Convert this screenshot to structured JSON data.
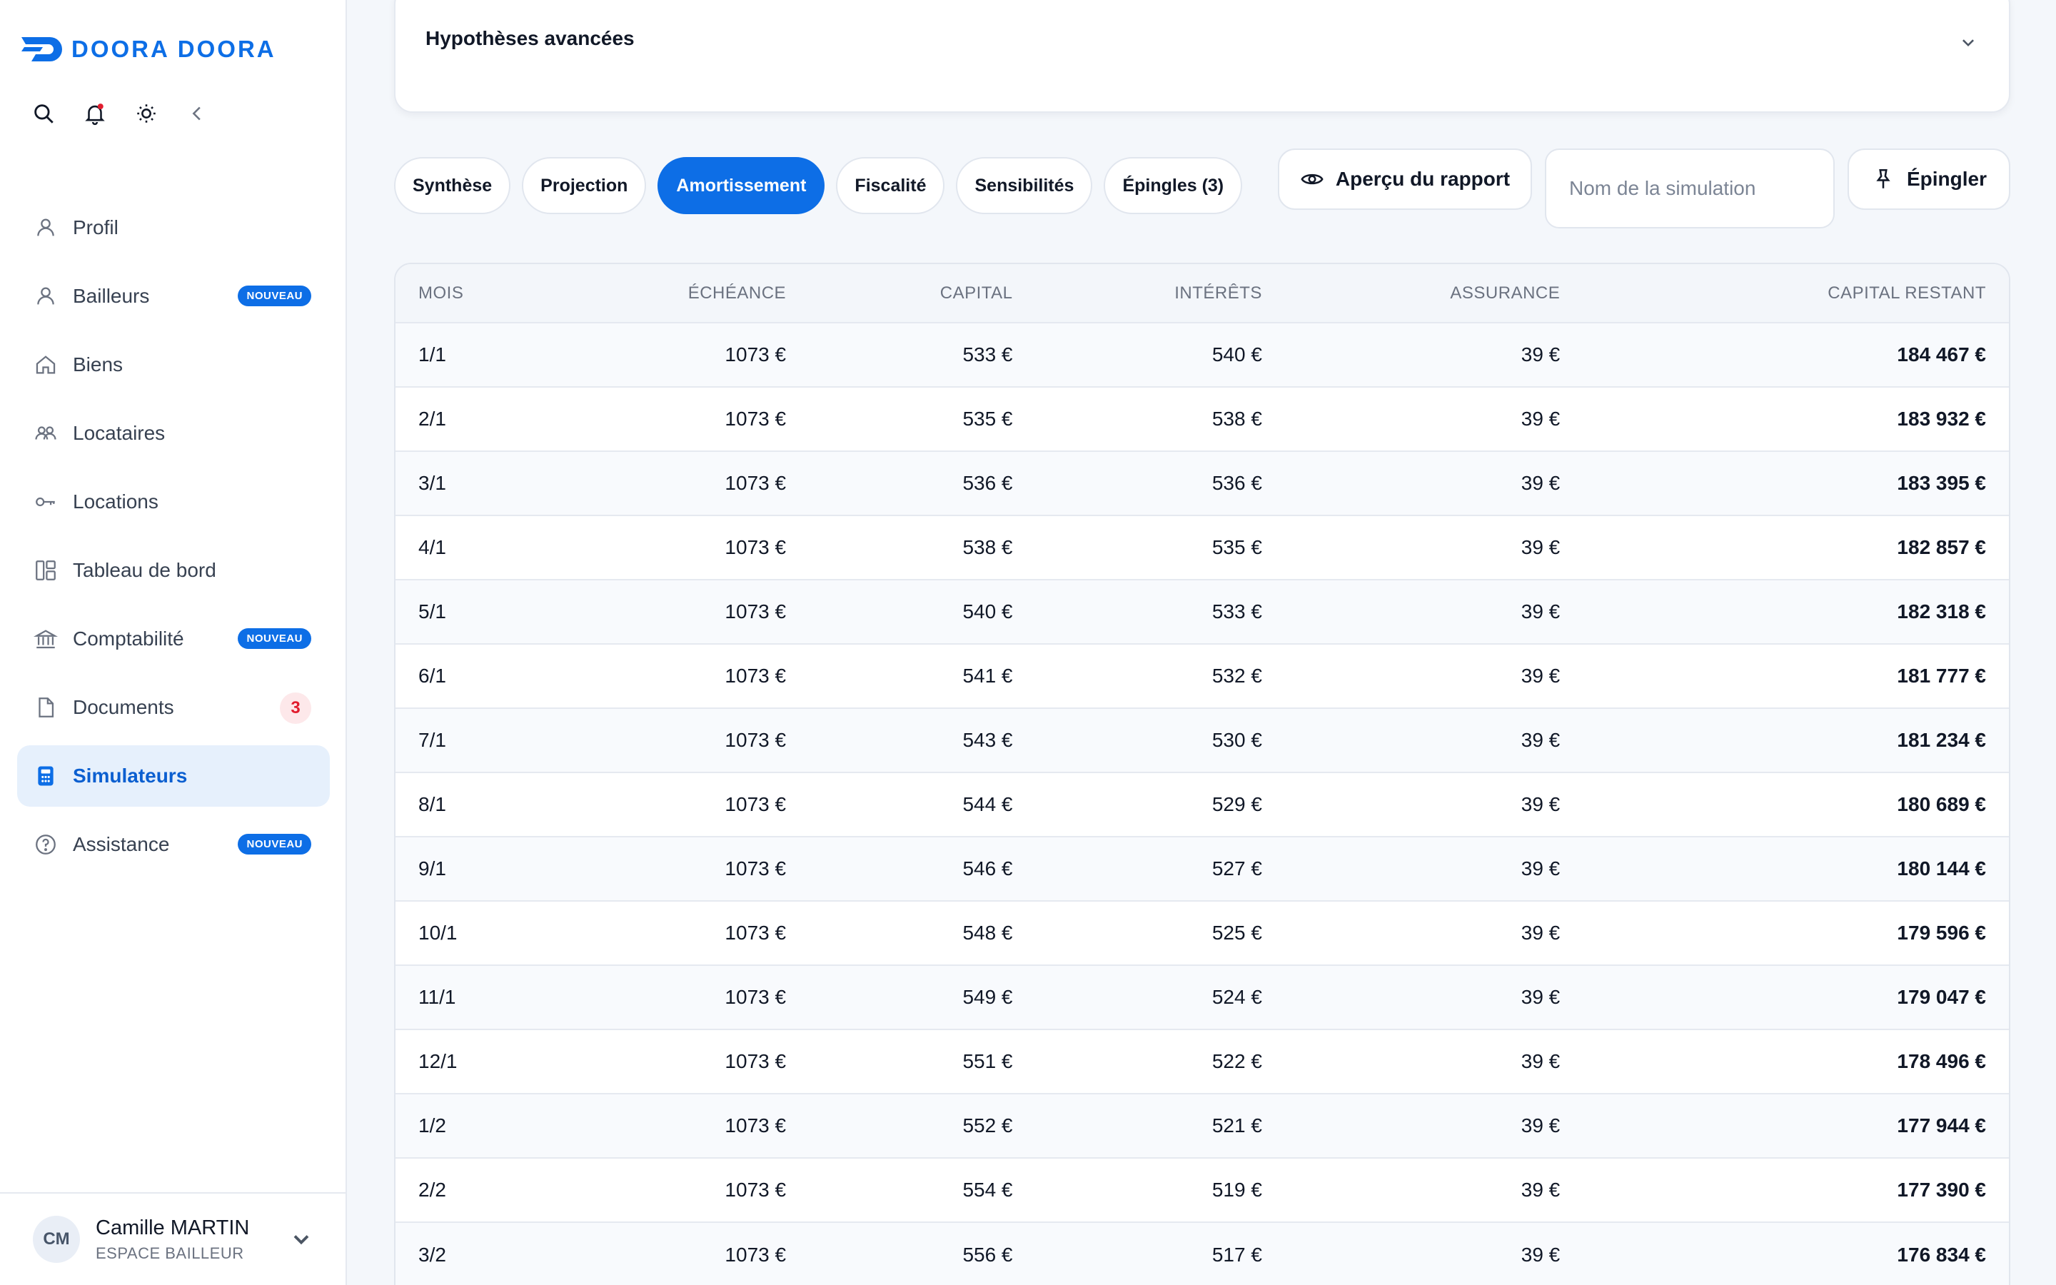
{
  "brand": {
    "name": "DOORA DOORA",
    "color": "#0d6ee6"
  },
  "toolbar_icons": [
    "search-icon",
    "bell-icon",
    "sun-icon",
    "collapse-icon"
  ],
  "nav": {
    "items": [
      {
        "label": "Profil",
        "icon": "user-icon"
      },
      {
        "label": "Bailleurs",
        "icon": "user-icon",
        "badge": "NOUVEAU"
      },
      {
        "label": "Biens",
        "icon": "home-icon"
      },
      {
        "label": "Locataires",
        "icon": "users-icon"
      },
      {
        "label": "Locations",
        "icon": "key-icon"
      },
      {
        "label": "Tableau de bord",
        "icon": "dashboard-icon"
      },
      {
        "label": "Comptabilité",
        "icon": "bank-icon",
        "badge": "NOUVEAU"
      },
      {
        "label": "Documents",
        "icon": "document-icon",
        "count": "3"
      },
      {
        "label": "Simulateurs",
        "icon": "calculator-icon",
        "active": true
      },
      {
        "label": "Assistance",
        "icon": "help-icon",
        "badge": "NOUVEAU"
      }
    ]
  },
  "user": {
    "initials": "CM",
    "name": "Camille MARTIN",
    "role": "ESPACE BAILLEUR"
  },
  "advanced": {
    "title": "Hypothèses avancées"
  },
  "tabs": [
    {
      "label": "Synthèse"
    },
    {
      "label": "Projection"
    },
    {
      "label": "Amortissement",
      "active": true
    },
    {
      "label": "Fiscalité"
    },
    {
      "label": "Sensibilités"
    },
    {
      "label": "Épingles (3)"
    }
  ],
  "actions": {
    "preview_label": "Aperçu du rapport",
    "sim_name_placeholder": "Nom de la simulation",
    "sim_name_value": "",
    "pin_label": "Épingler"
  },
  "table": {
    "headers": {
      "mois": "MOIS",
      "echeance": "ÉCHÉANCE",
      "capital": "CAPITAL",
      "interets": "INTÉRÊTS",
      "assurance": "ASSURANCE",
      "capital_restant": "CAPITAL RESTANT"
    },
    "rows": [
      {
        "mois": "1/1",
        "echeance": "1073 €",
        "capital": "533 €",
        "interets": "540 €",
        "assurance": "39 €",
        "restant": "184 467 €"
      },
      {
        "mois": "2/1",
        "echeance": "1073 €",
        "capital": "535 €",
        "interets": "538 €",
        "assurance": "39 €",
        "restant": "183 932 €"
      },
      {
        "mois": "3/1",
        "echeance": "1073 €",
        "capital": "536 €",
        "interets": "536 €",
        "assurance": "39 €",
        "restant": "183 395 €"
      },
      {
        "mois": "4/1",
        "echeance": "1073 €",
        "capital": "538 €",
        "interets": "535 €",
        "assurance": "39 €",
        "restant": "182 857 €"
      },
      {
        "mois": "5/1",
        "echeance": "1073 €",
        "capital": "540 €",
        "interets": "533 €",
        "assurance": "39 €",
        "restant": "182 318 €"
      },
      {
        "mois": "6/1",
        "echeance": "1073 €",
        "capital": "541 €",
        "interets": "532 €",
        "assurance": "39 €",
        "restant": "181 777 €"
      },
      {
        "mois": "7/1",
        "echeance": "1073 €",
        "capital": "543 €",
        "interets": "530 €",
        "assurance": "39 €",
        "restant": "181 234 €"
      },
      {
        "mois": "8/1",
        "echeance": "1073 €",
        "capital": "544 €",
        "interets": "529 €",
        "assurance": "39 €",
        "restant": "180 689 €"
      },
      {
        "mois": "9/1",
        "echeance": "1073 €",
        "capital": "546 €",
        "interets": "527 €",
        "assurance": "39 €",
        "restant": "180 144 €"
      },
      {
        "mois": "10/1",
        "echeance": "1073 €",
        "capital": "548 €",
        "interets": "525 €",
        "assurance": "39 €",
        "restant": "179 596 €"
      },
      {
        "mois": "11/1",
        "echeance": "1073 €",
        "capital": "549 €",
        "interets": "524 €",
        "assurance": "39 €",
        "restant": "179 047 €"
      },
      {
        "mois": "12/1",
        "echeance": "1073 €",
        "capital": "551 €",
        "interets": "522 €",
        "assurance": "39 €",
        "restant": "178 496 €"
      },
      {
        "mois": "1/2",
        "echeance": "1073 €",
        "capital": "552 €",
        "interets": "521 €",
        "assurance": "39 €",
        "restant": "177 944 €"
      },
      {
        "mois": "2/2",
        "echeance": "1073 €",
        "capital": "554 €",
        "interets": "519 €",
        "assurance": "39 €",
        "restant": "177 390 €"
      },
      {
        "mois": "3/2",
        "echeance": "1073 €",
        "capital": "556 €",
        "interets": "517 €",
        "assurance": "39 €",
        "restant": "176 834 €"
      }
    ]
  }
}
